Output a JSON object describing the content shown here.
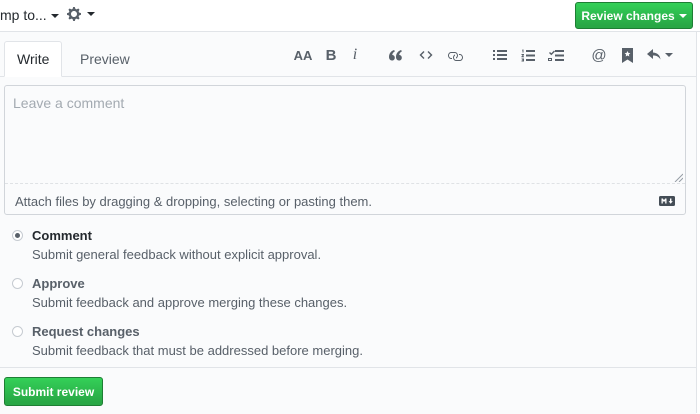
{
  "topbar": {
    "jump_label": "mp to...",
    "settings_icon": "gear-icon",
    "review_button": "Review changes"
  },
  "tabs": {
    "write": "Write",
    "preview": "Preview"
  },
  "toolbar": {
    "header_text": "AA",
    "bold_text": "B",
    "italic_text": "i",
    "mention_text": "@"
  },
  "editor": {
    "placeholder": "Leave a comment",
    "attach_hint": "Attach files by dragging & dropping, selecting or pasting them."
  },
  "options": [
    {
      "title": "Comment",
      "description": "Submit general feedback without explicit approval.",
      "checked": true
    },
    {
      "title": "Approve",
      "description": "Submit feedback and approve merging these changes.",
      "checked": false
    },
    {
      "title": "Request changes",
      "description": "Submit feedback that must be addressed before merging.",
      "checked": false
    }
  ],
  "footer": {
    "submit_label": "Submit review"
  },
  "colors": {
    "accent_green": "#28a745",
    "border": "#e1e4e8"
  }
}
